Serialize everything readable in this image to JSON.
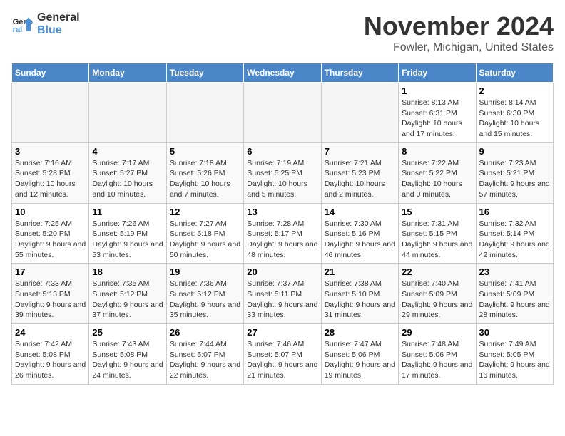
{
  "logo": {
    "line1": "General",
    "line2": "Blue"
  },
  "title": "November 2024",
  "location": "Fowler, Michigan, United States",
  "days_header": [
    "Sunday",
    "Monday",
    "Tuesday",
    "Wednesday",
    "Thursday",
    "Friday",
    "Saturday"
  ],
  "weeks": [
    [
      {
        "num": "",
        "info": ""
      },
      {
        "num": "",
        "info": ""
      },
      {
        "num": "",
        "info": ""
      },
      {
        "num": "",
        "info": ""
      },
      {
        "num": "",
        "info": ""
      },
      {
        "num": "1",
        "info": "Sunrise: 8:13 AM\nSunset: 6:31 PM\nDaylight: 10 hours and 17 minutes."
      },
      {
        "num": "2",
        "info": "Sunrise: 8:14 AM\nSunset: 6:30 PM\nDaylight: 10 hours and 15 minutes."
      }
    ],
    [
      {
        "num": "3",
        "info": "Sunrise: 7:16 AM\nSunset: 5:28 PM\nDaylight: 10 hours and 12 minutes."
      },
      {
        "num": "4",
        "info": "Sunrise: 7:17 AM\nSunset: 5:27 PM\nDaylight: 10 hours and 10 minutes."
      },
      {
        "num": "5",
        "info": "Sunrise: 7:18 AM\nSunset: 5:26 PM\nDaylight: 10 hours and 7 minutes."
      },
      {
        "num": "6",
        "info": "Sunrise: 7:19 AM\nSunset: 5:25 PM\nDaylight: 10 hours and 5 minutes."
      },
      {
        "num": "7",
        "info": "Sunrise: 7:21 AM\nSunset: 5:23 PM\nDaylight: 10 hours and 2 minutes."
      },
      {
        "num": "8",
        "info": "Sunrise: 7:22 AM\nSunset: 5:22 PM\nDaylight: 10 hours and 0 minutes."
      },
      {
        "num": "9",
        "info": "Sunrise: 7:23 AM\nSunset: 5:21 PM\nDaylight: 9 hours and 57 minutes."
      }
    ],
    [
      {
        "num": "10",
        "info": "Sunrise: 7:25 AM\nSunset: 5:20 PM\nDaylight: 9 hours and 55 minutes."
      },
      {
        "num": "11",
        "info": "Sunrise: 7:26 AM\nSunset: 5:19 PM\nDaylight: 9 hours and 53 minutes."
      },
      {
        "num": "12",
        "info": "Sunrise: 7:27 AM\nSunset: 5:18 PM\nDaylight: 9 hours and 50 minutes."
      },
      {
        "num": "13",
        "info": "Sunrise: 7:28 AM\nSunset: 5:17 PM\nDaylight: 9 hours and 48 minutes."
      },
      {
        "num": "14",
        "info": "Sunrise: 7:30 AM\nSunset: 5:16 PM\nDaylight: 9 hours and 46 minutes."
      },
      {
        "num": "15",
        "info": "Sunrise: 7:31 AM\nSunset: 5:15 PM\nDaylight: 9 hours and 44 minutes."
      },
      {
        "num": "16",
        "info": "Sunrise: 7:32 AM\nSunset: 5:14 PM\nDaylight: 9 hours and 42 minutes."
      }
    ],
    [
      {
        "num": "17",
        "info": "Sunrise: 7:33 AM\nSunset: 5:13 PM\nDaylight: 9 hours and 39 minutes."
      },
      {
        "num": "18",
        "info": "Sunrise: 7:35 AM\nSunset: 5:12 PM\nDaylight: 9 hours and 37 minutes."
      },
      {
        "num": "19",
        "info": "Sunrise: 7:36 AM\nSunset: 5:12 PM\nDaylight: 9 hours and 35 minutes."
      },
      {
        "num": "20",
        "info": "Sunrise: 7:37 AM\nSunset: 5:11 PM\nDaylight: 9 hours and 33 minutes."
      },
      {
        "num": "21",
        "info": "Sunrise: 7:38 AM\nSunset: 5:10 PM\nDaylight: 9 hours and 31 minutes."
      },
      {
        "num": "22",
        "info": "Sunrise: 7:40 AM\nSunset: 5:09 PM\nDaylight: 9 hours and 29 minutes."
      },
      {
        "num": "23",
        "info": "Sunrise: 7:41 AM\nSunset: 5:09 PM\nDaylight: 9 hours and 28 minutes."
      }
    ],
    [
      {
        "num": "24",
        "info": "Sunrise: 7:42 AM\nSunset: 5:08 PM\nDaylight: 9 hours and 26 minutes."
      },
      {
        "num": "25",
        "info": "Sunrise: 7:43 AM\nSunset: 5:08 PM\nDaylight: 9 hours and 24 minutes."
      },
      {
        "num": "26",
        "info": "Sunrise: 7:44 AM\nSunset: 5:07 PM\nDaylight: 9 hours and 22 minutes."
      },
      {
        "num": "27",
        "info": "Sunrise: 7:46 AM\nSunset: 5:07 PM\nDaylight: 9 hours and 21 minutes."
      },
      {
        "num": "28",
        "info": "Sunrise: 7:47 AM\nSunset: 5:06 PM\nDaylight: 9 hours and 19 minutes."
      },
      {
        "num": "29",
        "info": "Sunrise: 7:48 AM\nSunset: 5:06 PM\nDaylight: 9 hours and 17 minutes."
      },
      {
        "num": "30",
        "info": "Sunrise: 7:49 AM\nSunset: 5:05 PM\nDaylight: 9 hours and 16 minutes."
      }
    ]
  ]
}
